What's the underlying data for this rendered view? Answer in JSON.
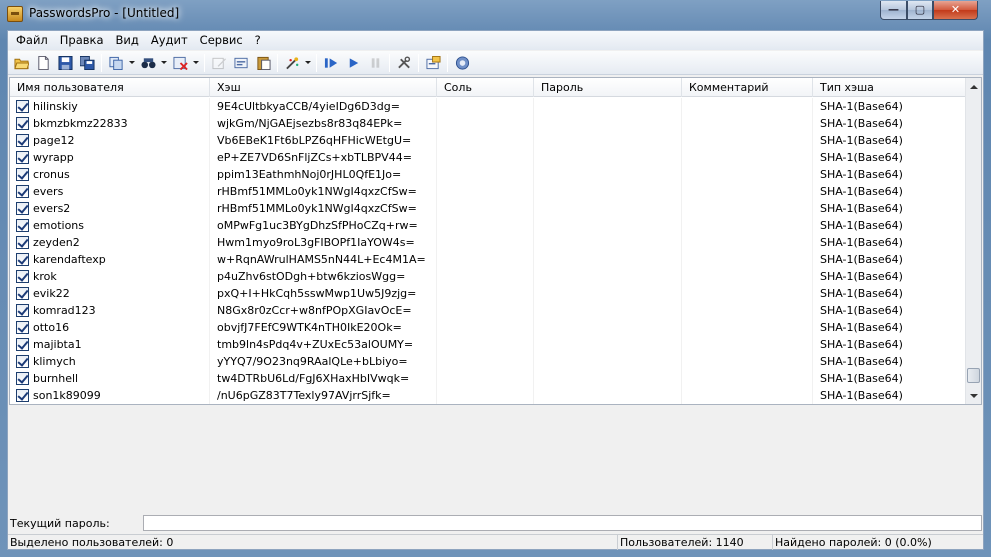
{
  "window": {
    "title": "PasswordsPro - [Untitled]",
    "min_glyph": "—",
    "max_glyph": "▢",
    "close_glyph": "✕"
  },
  "menu": [
    "Файл",
    "Правка",
    "Вид",
    "Аудит",
    "Сервис",
    "?"
  ],
  "toolbar_icons": [
    "open-folder-icon",
    "new-document-icon",
    "save-icon",
    "save-all-icon",
    "copy-icon",
    "find-icon",
    "delete-icon",
    "edit-icon",
    "add-user-icon",
    "paste-icon",
    "tools-wand-icon",
    "start-attack-icon",
    "resume-icon",
    "pause-icon",
    "settings-icon",
    "properties-icon",
    "help-icon"
  ],
  "grid": {
    "columns": [
      "Имя пользователя",
      "Хэш",
      "Соль",
      "Пароль",
      "Комментарий",
      "Тип хэша"
    ],
    "rows": [
      {
        "user": "hilinskiy",
        "hash": "9E4cUltbkyaCCB/4yieIDg6D3dg=",
        "salt": "",
        "password": "",
        "comment": "",
        "type": "SHA-1(Base64)"
      },
      {
        "user": "bkmzbkmz22833",
        "hash": "wjkGm/NjGAEjsezbs8r83q84EPk=",
        "salt": "",
        "password": "",
        "comment": "",
        "type": "SHA-1(Base64)"
      },
      {
        "user": "page12",
        "hash": "Vb6EBeK1Ft6bLPZ6qHFHicWEtgU=",
        "salt": "",
        "password": "",
        "comment": "",
        "type": "SHA-1(Base64)"
      },
      {
        "user": "wyrapp",
        "hash": "eP+ZE7VD6SnFljZCs+xbTLBPV44=",
        "salt": "",
        "password": "",
        "comment": "",
        "type": "SHA-1(Base64)"
      },
      {
        "user": "cronus",
        "hash": "ppim13EathmhNoj0rJHL0QfE1Jo=",
        "salt": "",
        "password": "",
        "comment": "",
        "type": "SHA-1(Base64)"
      },
      {
        "user": "evers",
        "hash": "rHBmf51MMLo0yk1NWgI4qxzCfSw=",
        "salt": "",
        "password": "",
        "comment": "",
        "type": "SHA-1(Base64)"
      },
      {
        "user": "evers2",
        "hash": "rHBmf51MMLo0yk1NWgI4qxzCfSw=",
        "salt": "",
        "password": "",
        "comment": "",
        "type": "SHA-1(Base64)"
      },
      {
        "user": "emotions",
        "hash": "oMPwFg1uc3BYgDhzSfPHoCZq+rw=",
        "salt": "",
        "password": "",
        "comment": "",
        "type": "SHA-1(Base64)"
      },
      {
        "user": "zeyden2",
        "hash": "Hwm1myo9roL3gFIBOPf1IaYOW4s=",
        "salt": "",
        "password": "",
        "comment": "",
        "type": "SHA-1(Base64)"
      },
      {
        "user": "karendaftexp",
        "hash": "w+RqnAWrulHAMS5nN44L+Ec4M1A=",
        "salt": "",
        "password": "",
        "comment": "",
        "type": "SHA-1(Base64)"
      },
      {
        "user": "krok",
        "hash": "p4uZhv6stODgh+btw6kziosWgg=",
        "salt": "",
        "password": "",
        "comment": "",
        "type": "SHA-1(Base64)"
      },
      {
        "user": "evik22",
        "hash": "pxQ+I+HkCqh5sswMwp1Uw5J9zjg=",
        "salt": "",
        "password": "",
        "comment": "",
        "type": "SHA-1(Base64)"
      },
      {
        "user": "komrad123",
        "hash": "N8Gx8r0zCcr+w8nfPOpXGIavOcE=",
        "salt": "",
        "password": "",
        "comment": "",
        "type": "SHA-1(Base64)"
      },
      {
        "user": "otto16",
        "hash": "obvjfJ7FEfC9WTK4nTH0IkE20Ok=",
        "salt": "",
        "password": "",
        "comment": "",
        "type": "SHA-1(Base64)"
      },
      {
        "user": "majibta1",
        "hash": "tmb9ln4sPdq4v+ZUxEc53alOUMY=",
        "salt": "",
        "password": "",
        "comment": "",
        "type": "SHA-1(Base64)"
      },
      {
        "user": "klimych",
        "hash": "yYYQ7/9O23nq9RAalQLe+bLbiyo=",
        "salt": "",
        "password": "",
        "comment": "",
        "type": "SHA-1(Base64)"
      },
      {
        "user": "burnhell",
        "hash": "tw4DTRbU6Ld/FgJ6XHaxHbIVwqk=",
        "salt": "",
        "password": "",
        "comment": "",
        "type": "SHA-1(Base64)"
      },
      {
        "user": "son1k89099",
        "hash": "/nU6pGZ83T7Texly97AVjrrSjfk=",
        "salt": "",
        "password": "",
        "comment": "",
        "type": "SHA-1(Base64)"
      }
    ]
  },
  "current_password": {
    "label": "Текущий пароль:",
    "value": ""
  },
  "status": {
    "selected": "Выделено пользователей: 0",
    "users": "Пользователей: 1140",
    "found": "Найдено паролей: 0 (0.0%)"
  }
}
